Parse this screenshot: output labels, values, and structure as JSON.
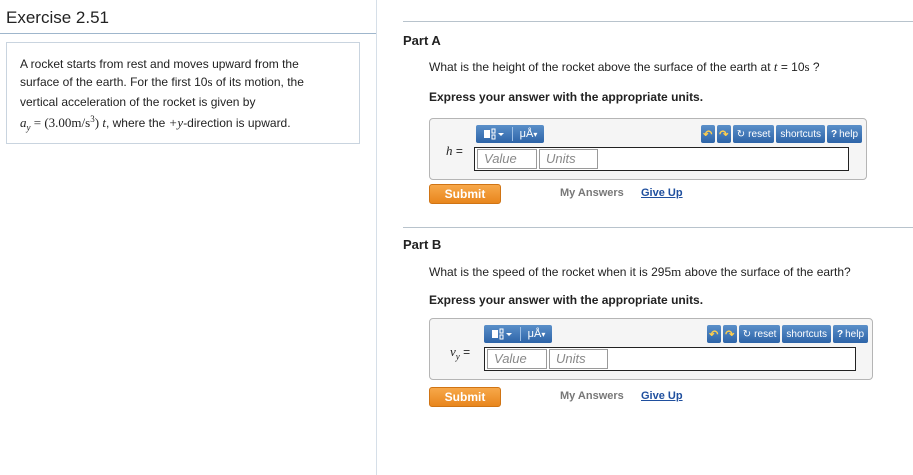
{
  "exercise": {
    "title": "Exercise 2.51"
  },
  "problem": {
    "line1": "A rocket starts from rest and moves upward from the",
    "line2_pre": "surface of the earth. For the first 10",
    "line2_unit": "s",
    "line2_post": " of its motion, the",
    "line3": "vertical acceleration of the rocket is given by",
    "line4_var": "a",
    "line4_sub": "y",
    "line4_eq": " = (3.00",
    "line4_unit": "m/s",
    "line4_exp": "3",
    "line4_close": ") ",
    "line4_t": "t",
    "line4_mid": ", where the ",
    "line4_dir": "+y",
    "line4_post": "-direction is upward."
  },
  "partA": {
    "title": "Part A",
    "question_pre": "What is the height of the rocket above the surface of the earth at ",
    "question_var": "t",
    "question_eq": " = 10",
    "question_unit": "s",
    "question_post": " ?",
    "instructions": "Express your answer with the appropriate units.",
    "answer_label": "h",
    "answer_eq": " =",
    "value_placeholder": "Value",
    "units_placeholder": "Units",
    "submit": "Submit",
    "my_answers": "My Answers",
    "give_up": "Give Up"
  },
  "partB": {
    "title": "Part B",
    "question_pre": "What is the speed of the rocket when it is 295",
    "question_unit": "m",
    "question_post": " above the surface of the earth?",
    "instructions": "Express your answer with the appropriate units.",
    "answer_label": "v",
    "answer_sub": "y",
    "answer_eq": " =",
    "value_placeholder": "Value",
    "units_placeholder": "Units",
    "submit": "Submit",
    "my_answers": "My Answers",
    "give_up": "Give Up"
  },
  "toolbar": {
    "template_icon": "template-icon",
    "units_symbol": "μÅ",
    "undo_icon": "undo-icon",
    "redo_icon": "redo-icon",
    "reset_label": "reset",
    "shortcuts_label": "shortcuts",
    "help_label": "help"
  },
  "colors": {
    "toolbar_blue": "#2d64a8",
    "submit_orange": "#e8861d",
    "link_blue": "#1f4f9e",
    "undo_orange": "#f0a020"
  }
}
